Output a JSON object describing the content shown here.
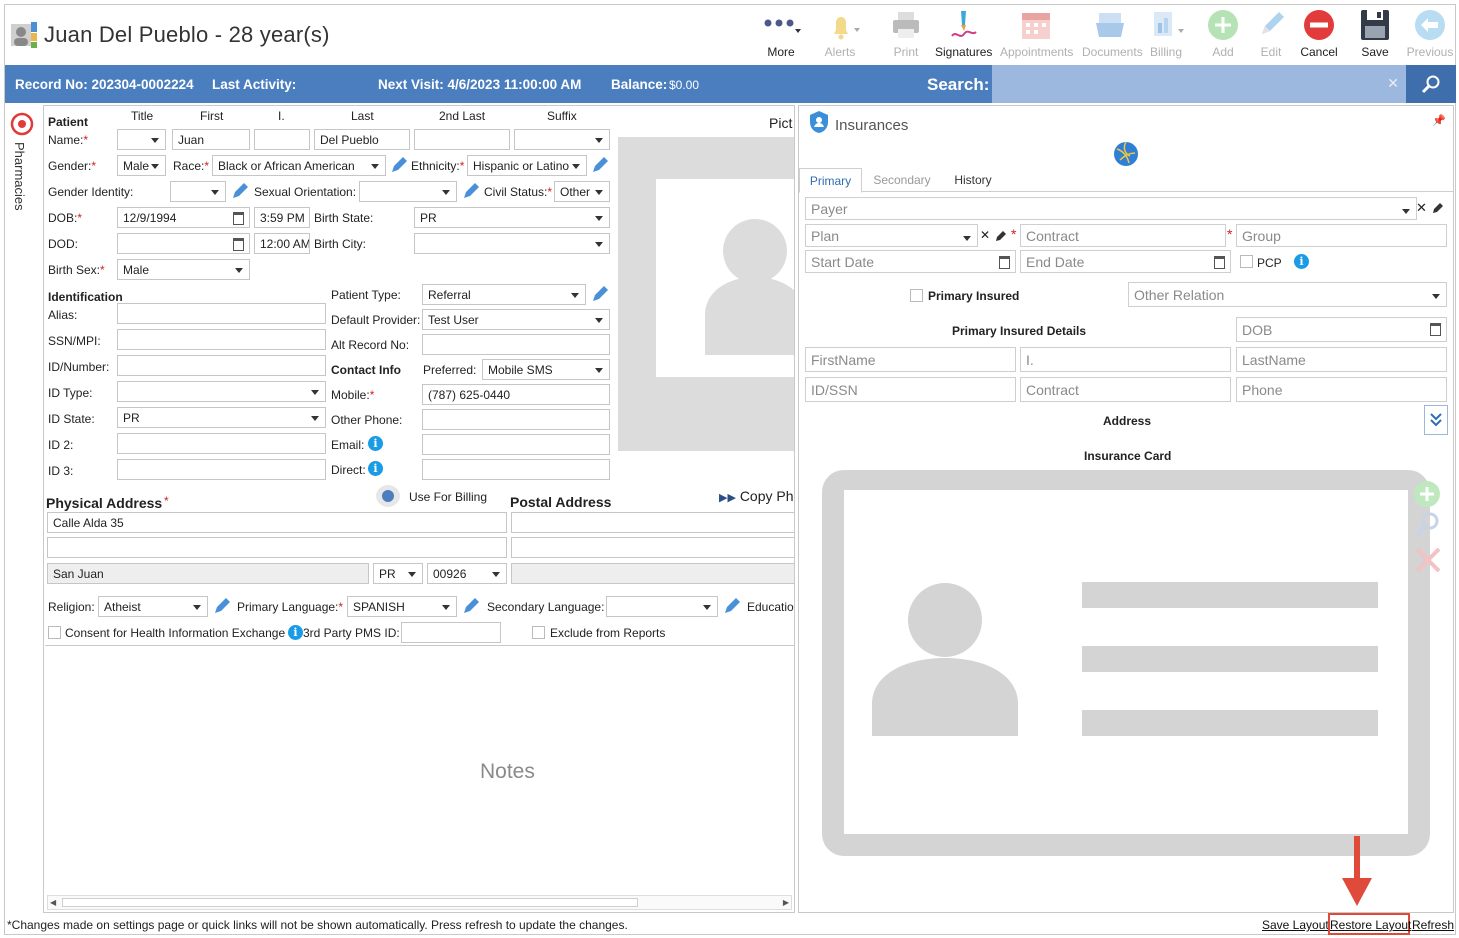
{
  "header": {
    "title": "Juan Del Pueblo - 28 year(s)"
  },
  "toolbar": {
    "more": "More",
    "alerts": "Alerts",
    "print": "Print",
    "signatures": "Signatures",
    "appointments": "Appointments",
    "documents": "Documents",
    "billing": "Billing",
    "add": "Add",
    "edit": "Edit",
    "cancel": "Cancel",
    "save": "Save",
    "previous": "Previous"
  },
  "infobar": {
    "record": "Record No: 202304-0002224",
    "last_activity": "Last Activity:",
    "next_visit": "Next Visit: 4/6/2023 11:00:00 AM",
    "balance_label": "Balance:",
    "balance_value": "$0.00",
    "search_label": "Search:"
  },
  "side_tab": "Pharmacies",
  "patient": {
    "section": "Patient",
    "col_title": "Title",
    "col_first": "First",
    "col_i": "I.",
    "col_last": "Last",
    "col_2nd_last": "2nd Last",
    "col_suffix": "Suffix",
    "name_label": "Name:",
    "first": "Juan",
    "last": "Del Pueblo",
    "gender_label": "Gender:",
    "gender": "Male",
    "race_label": "Race:",
    "race": "Black or African American",
    "ethnicity_label": "Ethnicity:",
    "ethnicity": "Hispanic or Latino",
    "gender_identity_label": "Gender Identity:",
    "sexual_orientation_label": "Sexual Orientation:",
    "civil_status_label": "Civil Status:",
    "civil_status": "Other",
    "dob_label": "DOB:",
    "dob": "12/9/1994",
    "dob_time": "3:59 PM",
    "birth_state_label": "Birth State:",
    "birth_state": "PR",
    "dod_label": "DOD:",
    "dod_time": "12:00 AM",
    "birth_city_label": "Birth City:",
    "birth_sex_label": "Birth Sex:",
    "birth_sex": "Male",
    "picture_label": "Pict"
  },
  "identification": {
    "section": "Identification",
    "alias": "Alias:",
    "ssn": "SSN/MPI:",
    "id_number": "ID/Number:",
    "id_type": "ID Type:",
    "id_state_label": "ID State:",
    "id_state": "PR",
    "id2": "ID 2:",
    "id3": "ID 3:"
  },
  "right_fields": {
    "patient_type_label": "Patient Type:",
    "patient_type": "Referral",
    "default_provider_label": "Default Provider:",
    "default_provider": "Test User",
    "alt_record_label": "Alt Record No:",
    "contact_info": "Contact Info",
    "preferred_label": "Preferred:",
    "preferred": "Mobile SMS",
    "mobile_label": "Mobile:",
    "mobile": "(787) 625-0440",
    "other_phone_label": "Other Phone:",
    "email_label": "Email:",
    "direct_label": "Direct:"
  },
  "address": {
    "physical": "Physical Address",
    "use_for_billing": "Use For Billing",
    "postal": "Postal Address",
    "copy": "Copy Ph",
    "street": "Calle Alda 35",
    "city": "San Juan",
    "state": "PR",
    "zip": "00926"
  },
  "misc": {
    "religion_label": "Religion:",
    "religion": "Atheist",
    "primary_lang_label": "Primary Language:",
    "primary_lang": "SPANISH",
    "secondary_lang_label": "Secondary Language:",
    "education_label": "Educatio",
    "consent": "Consent for Health Information Exchange",
    "third_party": "3rd Party PMS ID:",
    "exclude": "Exclude from Reports"
  },
  "notes": {
    "placeholder": "Notes"
  },
  "insurances": {
    "title": "Insurances",
    "tabs": [
      "Primary",
      "Secondary",
      "History"
    ],
    "payer": "Payer",
    "plan": "Plan",
    "contract": "Contract",
    "group": "Group",
    "start_date": "Start Date",
    "end_date": "End Date",
    "pcp": "PCP",
    "primary_insured": "Primary Insured",
    "other_relation": "Other Relation",
    "details": "Primary Insured Details",
    "dob": "DOB",
    "first_name": "FirstName",
    "i": "I.",
    "last_name": "LastName",
    "id_ssn": "ID/SSN",
    "contract2": "Contract",
    "phone": "Phone",
    "address": "Address",
    "card": "Insurance Card"
  },
  "footer": {
    "note": "*Changes made on settings page or quick links will not be shown automatically. Press refresh to update the changes.",
    "save_layout": "Save Layout",
    "restore_layout": "Restore Layout",
    "refresh": "Refresh"
  },
  "colors": {
    "accent": "#4a7ebf",
    "highlight": "#e04a3a"
  }
}
